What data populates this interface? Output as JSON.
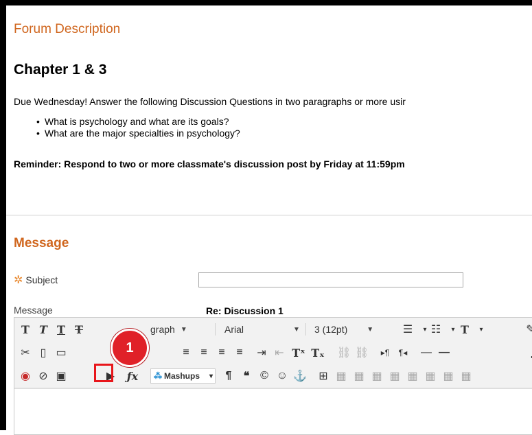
{
  "forum": {
    "heading": "Forum Description",
    "chapter": "Chapter 1 & 3",
    "description": "Due Wednesday! Answer the following Discussion Questions in two paragraphs or more usir",
    "bullets": [
      "What is psychology and what are its goals?",
      "What are the major specialties in psychology?"
    ],
    "reminder": "Reminder:  Respond to two or more classmate's discussion post by Friday at 11:59pm"
  },
  "message": {
    "heading": "Message",
    "subject_label": "Subject",
    "subject_value": "",
    "message_label": "Message",
    "reply_title": "Re: Discussion 1"
  },
  "toolbar": {
    "paragraph_value": "graph",
    "font_value": "Arial",
    "size_value": "3 (12pt)",
    "mashups_label": "Mashups"
  },
  "annotation": {
    "step_number": "1",
    "highlight_color": "#e8161b"
  },
  "colors": {
    "accent": "#d0661e"
  }
}
